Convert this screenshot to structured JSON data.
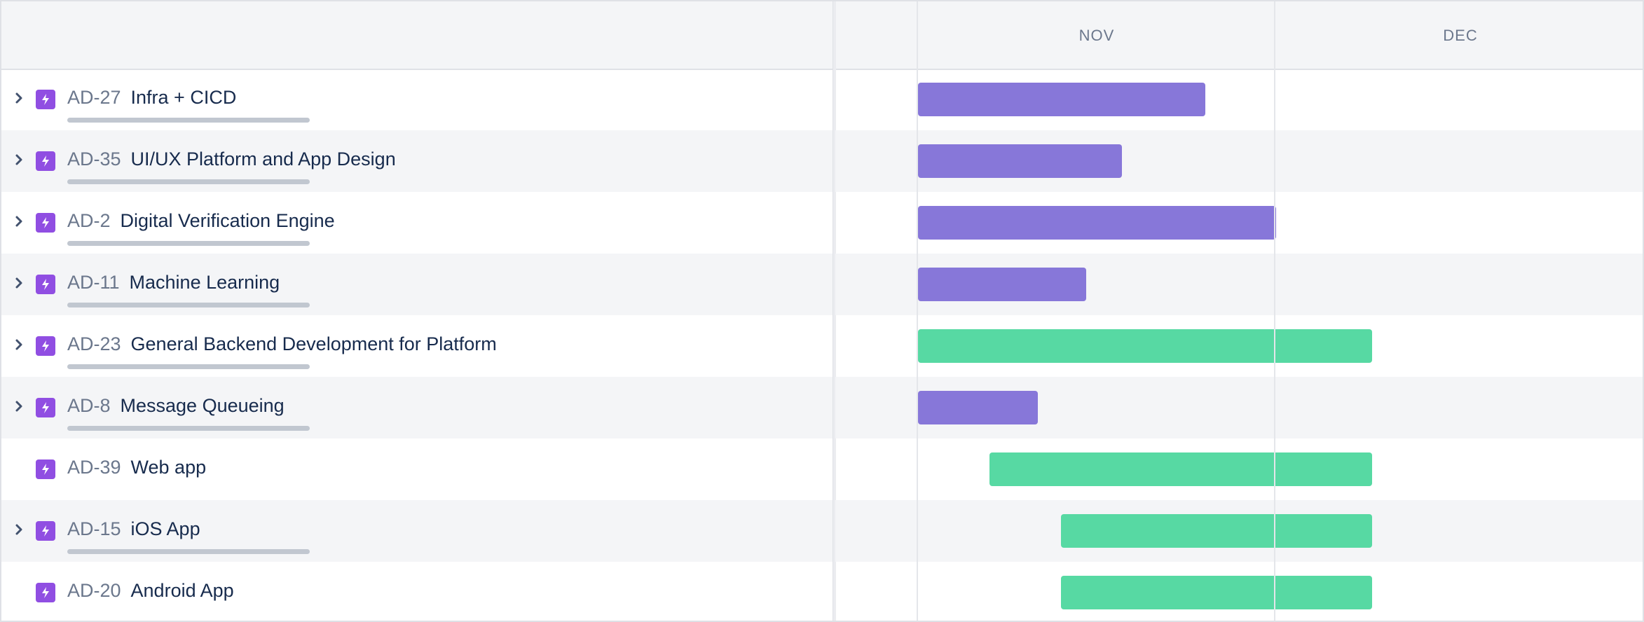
{
  "timeline": {
    "months": [
      "NOV",
      "DEC"
    ]
  },
  "colors": {
    "purple_bar": "#8777d9",
    "green_bar": "#57d9a3",
    "epic_icon": "#904ee2"
  },
  "issues": [
    {
      "key": "AD-27",
      "title": "Infra + CICD",
      "expandable": true,
      "color": "purple"
    },
    {
      "key": "AD-35",
      "title": "UI/UX Platform and App Design",
      "expandable": true,
      "color": "purple"
    },
    {
      "key": "AD-2",
      "title": "Digital Verification Engine",
      "expandable": true,
      "color": "purple"
    },
    {
      "key": "AD-11",
      "title": "Machine Learning",
      "expandable": true,
      "color": "purple"
    },
    {
      "key": "AD-23",
      "title": "General Backend Development for Platform",
      "expandable": true,
      "color": "green"
    },
    {
      "key": "AD-8",
      "title": "Message Queueing",
      "expandable": true,
      "color": "purple"
    },
    {
      "key": "AD-39",
      "title": "Web app",
      "expandable": false,
      "color": "green"
    },
    {
      "key": "AD-15",
      "title": "iOS App",
      "expandable": true,
      "color": "green"
    },
    {
      "key": "AD-20",
      "title": "Android App",
      "expandable": false,
      "color": "green"
    }
  ]
}
